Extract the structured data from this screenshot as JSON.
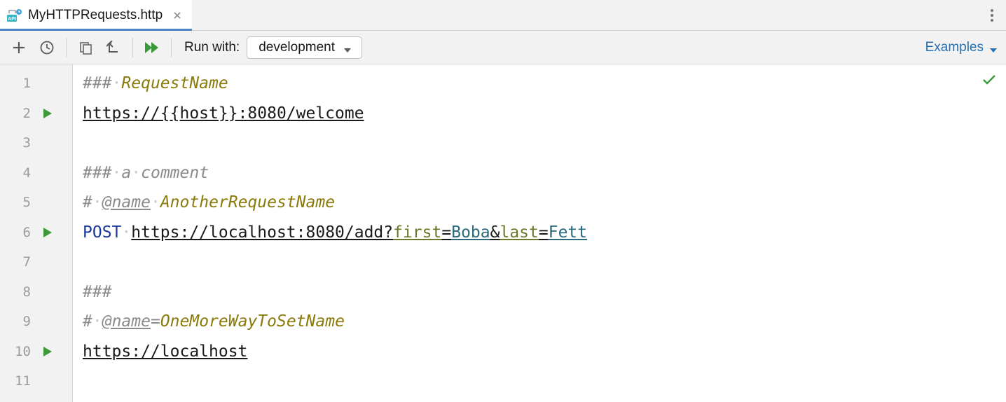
{
  "tab": {
    "filename": "MyHTTPRequests.http"
  },
  "toolbar": {
    "run_with_label": "Run with:",
    "environment": "development",
    "examples_label": "Examples"
  },
  "gutter": {
    "lines": [
      "1",
      "2",
      "3",
      "4",
      "5",
      "6",
      "7",
      "8",
      "9",
      "10",
      "11"
    ],
    "run_markers": [
      2,
      6,
      10
    ]
  },
  "code": {
    "l1": {
      "hash": "###",
      "dot": "·",
      "name": "RequestName"
    },
    "l2": {
      "url": "https://{{host}}:8080/welcome"
    },
    "l4": {
      "hash": "###",
      "dot1": "·",
      "a": "a",
      "dot2": "·",
      "comment": "comment"
    },
    "l5": {
      "hashsym": "#",
      "dot1": "·",
      "atname": "@name",
      "dot2": "·",
      "name": "AnotherRequestName"
    },
    "l6": {
      "method": "POST",
      "dot": "·",
      "url_base": "https://localhost:8080/add?",
      "q1k": "first",
      "eq": "=",
      "q1v": "Boba",
      "amp": "&",
      "q2k": "last",
      "q2v": "Fett"
    },
    "l8": {
      "hash": "###"
    },
    "l9": {
      "hashsym": "#",
      "dot": "·",
      "atname": "@name",
      "eq": "=",
      "name": "OneMoreWayToSetName"
    },
    "l10": {
      "url": "https://localhost"
    }
  },
  "colors": {
    "accent_blue": "#2470b3",
    "gutter_bg": "#f2f2f2",
    "run_green": "#3a9a3a"
  }
}
